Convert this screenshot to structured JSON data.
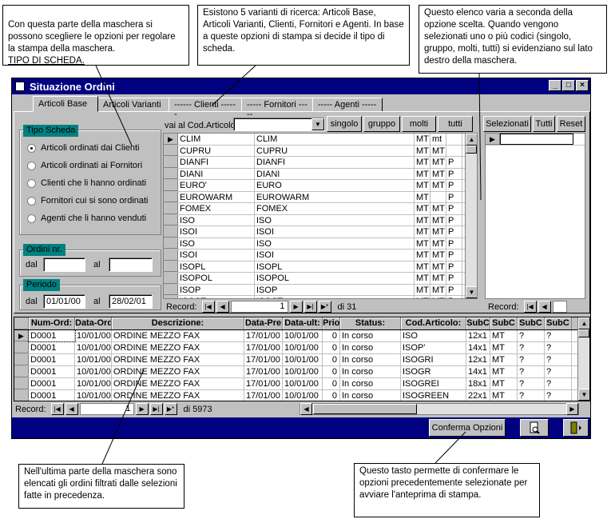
{
  "callouts": {
    "c1": "Con questa parte della maschera si possono scegliere le opzioni per regolare la stampa della maschera.",
    "c1_link": "TIPO DI SCHEDA.",
    "c2": "Esistono 5 varianti di ricerca: Articoli Base, Articoli Varianti, Clienti, Fornitori e Agenti. In base a queste opzioni di stampa si decide il tipo di scheda.",
    "c3": "Questo elenco varia a seconda della opzione scelta. Quando vengono selezionati uno o più codici (singolo, gruppo, molti, tutti) si evidenziano sul lato destro della maschera.",
    "c4": "Nell'ultima parte della maschera sono elencati gli ordini filtrati dalle selezioni fatte in precedenza.",
    "c5": "Questo tasto permette  di confermare le opzioni  precedentemente selezionate per avviare l'anteprima di stampa."
  },
  "window": {
    "title": "Situazione Ordini",
    "min": "_",
    "max": "□",
    "close": "×"
  },
  "tabs": [
    "Articoli Base",
    "Articoli Varianti",
    "------ Clienti ------",
    "----- Fornitori -----",
    "----- Agenti -----"
  ],
  "tipo_scheda": {
    "label": "Tipo Scheda",
    "options": [
      {
        "label": "Articoli ordinati dai Clienti",
        "selected": true
      },
      {
        "label": "Articoli ordinati ai Fornitori",
        "selected": false
      },
      {
        "label": "Clienti che li hanno ordinati",
        "selected": false
      },
      {
        "label": "Fornitori cui si sono ordinati",
        "selected": false
      },
      {
        "label": "Agenti che li hanno venduti",
        "selected": false
      }
    ]
  },
  "ordini": {
    "label": "Ordini nr.",
    "dal": "dal",
    "al": "al",
    "dal_value": "",
    "al_value": ""
  },
  "periodo": {
    "label": "Periodo",
    "dal": "dal",
    "al": "al",
    "dal_value": "01/01/00",
    "al_value": "28/02/01"
  },
  "cod_articolo": {
    "label": "vai al Cod.Articolo",
    "buttons": [
      "singolo",
      "gruppo",
      "molti",
      "tutti"
    ],
    "rows": [
      [
        "CLIM",
        "CLIM",
        "MT",
        "mt",
        ""
      ],
      [
        "CUPRU",
        "CUPRU",
        "MT",
        "MT",
        ""
      ],
      [
        "DIANFI",
        "DIANFI",
        "MT",
        "MT",
        "P"
      ],
      [
        "DIANI",
        "DIANI",
        "MT",
        "MT",
        "P"
      ],
      [
        "EURO'",
        "EURO",
        "MT",
        "MT",
        "P"
      ],
      [
        "EUROWARM",
        "EUROWARM",
        "MT",
        "",
        "P"
      ],
      [
        "FOMEX",
        "FOMEX",
        "MT",
        "MT",
        "P"
      ],
      [
        "ISO",
        "ISO",
        "MT",
        "MT",
        "P"
      ],
      [
        "ISOI",
        "ISOI",
        "MT",
        "MT",
        "P"
      ],
      [
        "ISO",
        "ISO",
        "MT",
        "MT",
        "P"
      ],
      [
        "ISOI",
        "ISOI",
        "MT",
        "MT",
        "P"
      ],
      [
        "ISOPL",
        "ISOPL",
        "MT",
        "MT",
        "P"
      ],
      [
        "ISOPOL",
        "ISOPOL",
        "MT",
        "MT",
        "P"
      ],
      [
        "ISOP",
        "ISOP",
        "MT",
        "MT",
        "P"
      ],
      [
        "ISOST",
        "ISOST",
        "MT",
        "MT",
        "P"
      ]
    ],
    "record_label": "Record:",
    "record_value": "1",
    "record_total": "di 31"
  },
  "selezionati": {
    "label": "Selezionati",
    "tutti": "Tutti",
    "reset": "Reset",
    "record_label": "Record:"
  },
  "ordini_grid": {
    "headers": [
      "Num-Ord:",
      "Data-Ord",
      "Descrizione:",
      "Data-Pre",
      "Data-ult:",
      "Prio",
      "Status:",
      "Cod.Articolo:",
      "SubC",
      "SubC",
      "SubC",
      "SubC"
    ],
    "rows": [
      [
        "D0001",
        "10/01/00",
        "ORDINE MEZZO FAX",
        "17/01/00",
        "10/01/00",
        "0",
        "In corso",
        "ISO",
        "12x1",
        "MT",
        "?",
        "?"
      ],
      [
        "D0001",
        "10/01/00",
        "ORDINE MEZZO FAX",
        "17/01/00",
        "10/01/00",
        "0",
        "In corso",
        "ISOP'",
        "14x1",
        "MT",
        "?",
        "?"
      ],
      [
        "D0001",
        "10/01/00",
        "ORDINE MEZZO FAX",
        "17/01/00",
        "10/01/00",
        "0",
        "In corso",
        "ISOGRI",
        "12x1",
        "MT",
        "?",
        "?"
      ],
      [
        "D0001",
        "10/01/00",
        "ORDINE MEZZO FAX",
        "17/01/00",
        "10/01/00",
        "0",
        "In corso",
        "ISOGR",
        "14x1",
        "MT",
        "?",
        "?"
      ],
      [
        "D0001",
        "10/01/00",
        "ORDINE MEZZO FAX",
        "17/01/00",
        "10/01/00",
        "0",
        "In corso",
        "ISOGREI",
        "18x1",
        "MT",
        "?",
        "?"
      ],
      [
        "D0001",
        "10/01/00",
        "ORDINE MEZZO FAX",
        "17/01/00",
        "10/01/00",
        "0",
        "In corso",
        "ISOGREEN",
        "22x1",
        "MT",
        "?",
        "?"
      ]
    ],
    "record_label": "Record:",
    "record_value": "1",
    "record_total": "di 5973"
  },
  "conferma": "Conferma Opzioni",
  "icons": {
    "preview": "print-preview-icon",
    "exit": "exit-door-icon"
  }
}
